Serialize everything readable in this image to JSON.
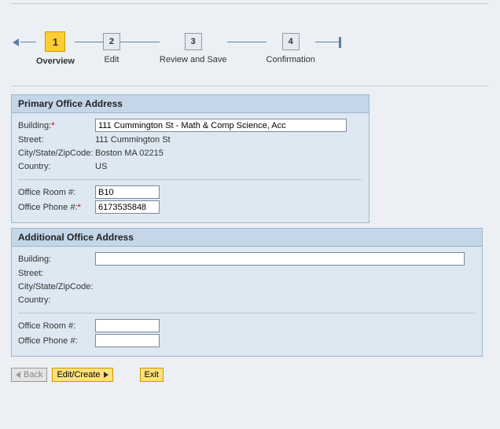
{
  "wizard": {
    "steps": [
      {
        "num": "1",
        "label": "Overview",
        "active": true
      },
      {
        "num": "2",
        "label": "Edit",
        "active": false
      },
      {
        "num": "3",
        "label": "Review and Save",
        "active": false
      },
      {
        "num": "4",
        "label": "Confirmation",
        "active": false
      }
    ]
  },
  "primary": {
    "title": "Primary Office Address",
    "building_label": "Building:",
    "building_value": "111 Cummington St - Math & Comp Science, Acc",
    "street_label": "Street:",
    "street_value": "111   Cummington St",
    "csz_label": "City/State/ZipCode:",
    "csz_value": "Boston   MA   02215",
    "country_label": "Country:",
    "country_value": "US",
    "room_label": "Office Room #:",
    "room_value": "B10",
    "phone_label": "Office Phone #:",
    "phone_value": "6173535848"
  },
  "additional": {
    "title": "Additional Office Address",
    "building_label": "Building:",
    "building_value": "",
    "street_label": "Street:",
    "street_value": "",
    "csz_label": "City/State/ZipCode:",
    "csz_value": "",
    "country_label": "Country:",
    "country_value": "",
    "room_label": "Office Room #:",
    "room_value": "",
    "phone_label": "Office Phone #:",
    "phone_value": ""
  },
  "buttons": {
    "back": "Back",
    "edit": "Edit/Create",
    "exit": "Exit"
  }
}
